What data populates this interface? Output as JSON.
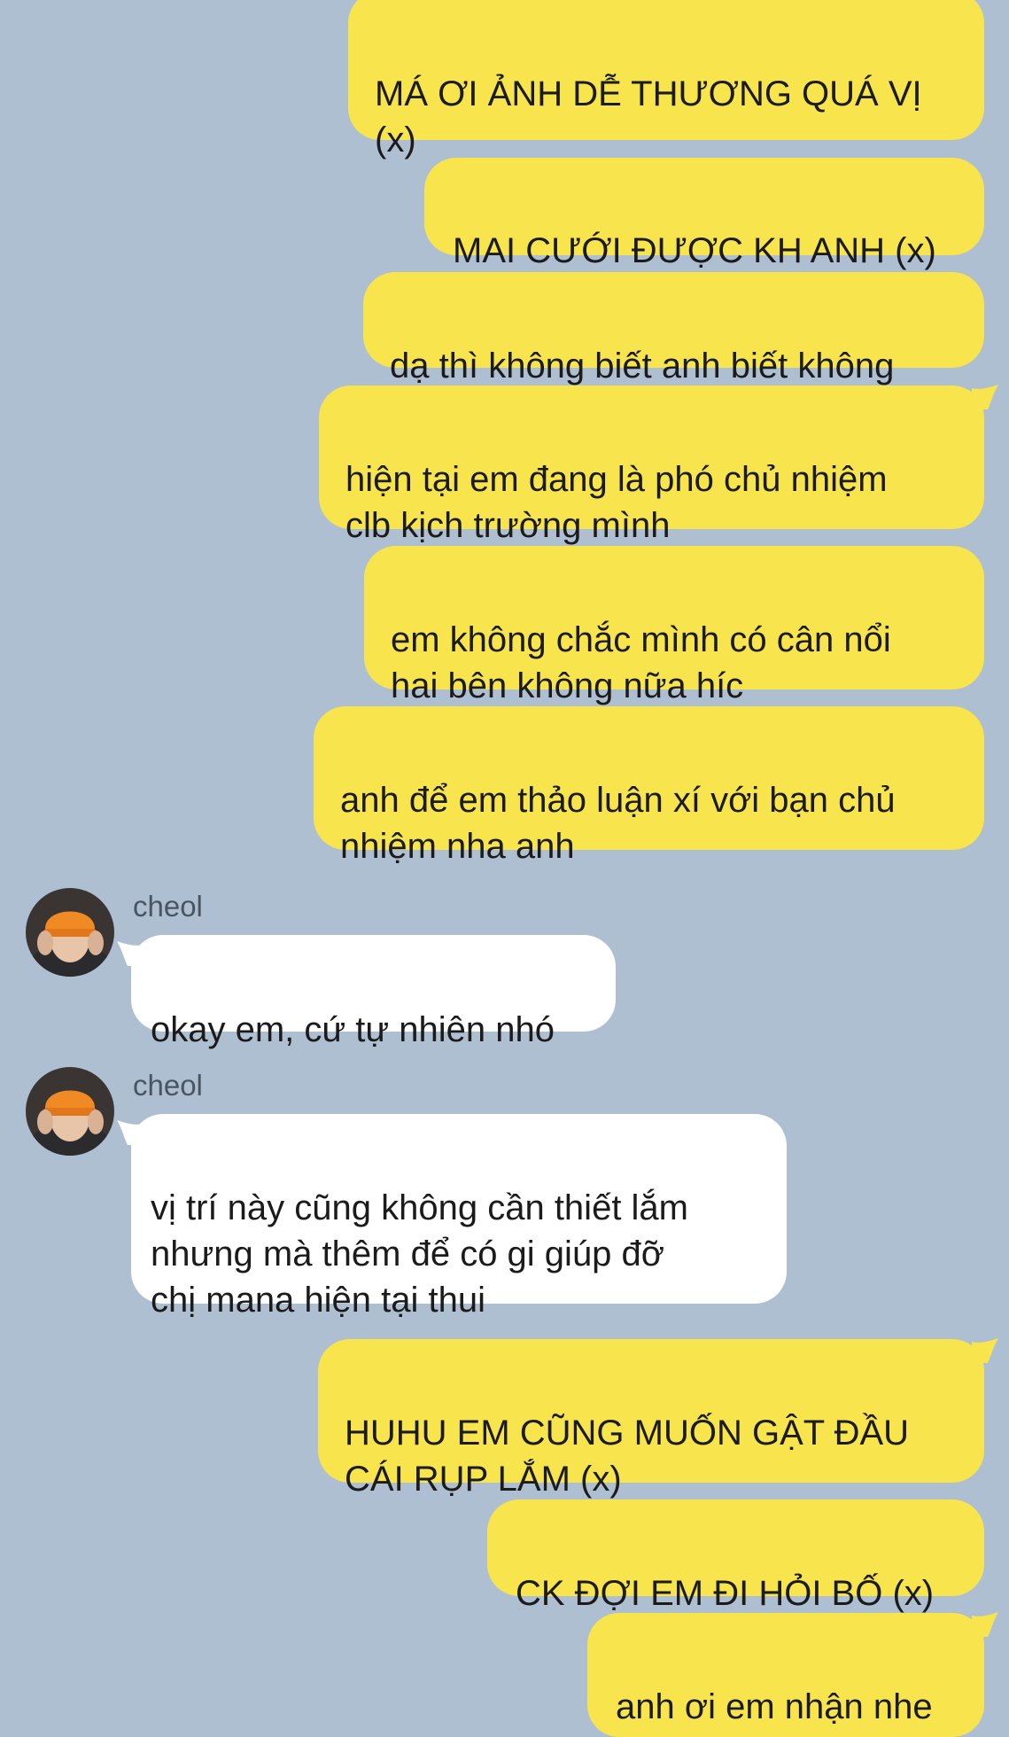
{
  "messages": [
    {
      "dir": "out",
      "text": "MÁ ƠI ẢNH DỄ THƯƠNG QUÁ VỊ\n(x)"
    },
    {
      "dir": "out",
      "text": "MAI CƯỚI ĐƯỢC KH ANH (x)"
    },
    {
      "dir": "out",
      "text": "dạ thì không biết anh biết không"
    },
    {
      "dir": "out",
      "text": "hiện tại em đang là phó chủ nhiệm\nclb kịch trường mình"
    },
    {
      "dir": "out",
      "text": "em không chắc mình có cân nổi\nhai bên không nữa híc"
    },
    {
      "dir": "out",
      "text": "anh để em thảo luận xí với bạn chủ\nnhiệm nha anh"
    },
    {
      "dir": "in",
      "sender": "cheol",
      "text": "okay em, cứ tự nhiên nhó"
    },
    {
      "dir": "in",
      "sender": "cheol",
      "text": "vị trí này cũng không cần thiết lắm\nnhưng mà thêm để có gi giúp đỡ\nchị mana hiện tại thui"
    },
    {
      "dir": "out",
      "text": "HUHU EM CŨNG MUỐN GẬT ĐẦU\nCÁI RỤP LẮM (x)"
    },
    {
      "dir": "out",
      "text": "CK ĐỢI EM ĐI HỎI BỐ (x)"
    },
    {
      "dir": "out",
      "text": "anh ơi em nhận nhe"
    }
  ],
  "colors": {
    "background": "#aebfd2",
    "outgoing_bubble": "#f8e54d",
    "incoming_bubble": "#ffffff",
    "avatar_hat": "#f08a24"
  },
  "icons": {
    "avatar": "contact-avatar-photo"
  }
}
